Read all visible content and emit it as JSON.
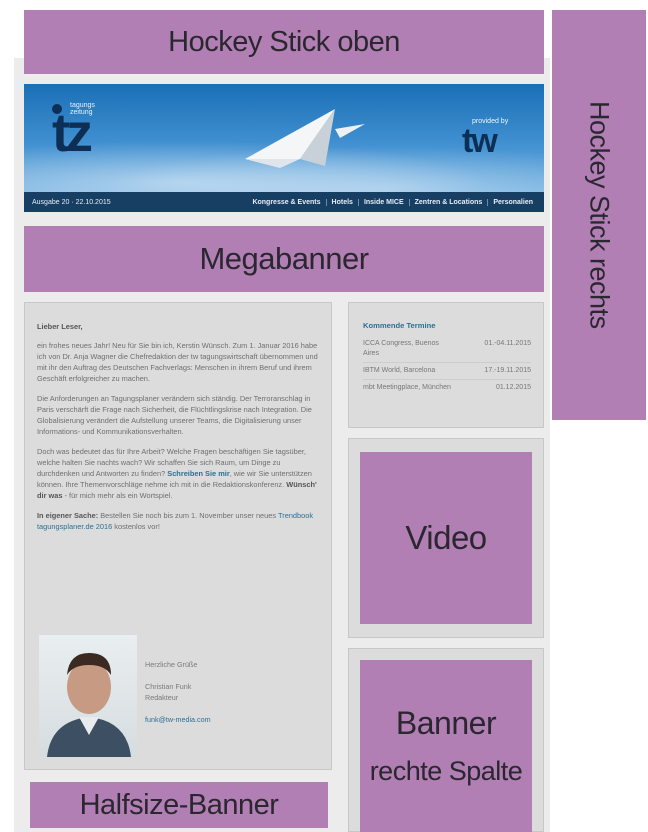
{
  "labels": {
    "hockey_top": "Hockey Stick oben",
    "hockey_right": "Hockey Stick rechts",
    "megabanner": "Megabanner",
    "video": "Video",
    "banner_right_line1": "Banner",
    "banner_right_line2": "rechte Spalte",
    "halfsize": "Halfsize-Banner"
  },
  "header": {
    "logo_text": "tz",
    "logo_sub": "tagungs zeitung",
    "provided_by": "provided by",
    "provider_logo": "tw",
    "issue": "Ausgabe 20 · 22.10.2015",
    "nav": [
      "Kongresse & Events",
      "Hotels",
      "Inside MICE",
      "Zentren & Locations",
      "Personalien"
    ]
  },
  "letter": {
    "greeting": "Lieber Leser,",
    "p1": "ein frohes neues Jahr! Neu für Sie bin ich, Kerstin Wünsch. Zum 1. Januar 2016 habe ich von Dr. Anja Wagner die Chefredaktion der tw tagungswirtschaft übernommen und mit ihr den Auftrag des Deutschen Fachverlags: Menschen in ihrem Beruf und ihrem Geschäft erfolgreicher zu machen.",
    "p2": "Die Anforderungen an Tagungsplaner verändern sich ständig. Der Terroranschlag in Paris verschärft die Frage nach Sicherheit, die Flüchtlingskrise nach Integration. Die Globalisierung verändert die Aufstellung unserer Teams, die Digitalisierung unser Informations- und Kommunikationsverhalten.",
    "p3_a": "Doch was bedeutet das für Ihre Arbeit? Welche Fragen beschäftigen Sie tagsüber, welche halten Sie nachts wach? Wir schaffen Sie sich Raum, um Dinge zu durchdenken und Antworten zu finden?",
    "p3_link": "Schreiben Sie mir",
    "p3_b": ", wie wir Sie unterstützen können. Ihre Themenvorschläge nehme ich mit in die Redaktionskonferenz.",
    "p3_bold": "Wünsch' dir was",
    "p3_c": " - für mich mehr als ein Wortspiel.",
    "p4_bold": "In eigener Sache:",
    "p4_a": " Bestellen Sie noch bis zum 1. November unser neues ",
    "p4_link": "Trendbook tagungsplaner.de 2016",
    "p4_b": " kostenlos vor!"
  },
  "signature": {
    "closing": "Herzliche Grüße",
    "name": "Christian Funk",
    "role": "Redakteur",
    "email": "funk@tw-media.com"
  },
  "events": {
    "title": "Kommende Termine",
    "items": [
      {
        "name": "ICCA Congress, Buenos Aires",
        "date": "01.-04.11.2015"
      },
      {
        "name": "IBTM World, Barcelona",
        "date": "17.-19.11.2015"
      },
      {
        "name": "mbt Meetingplace, München",
        "date": "01.12.2015"
      }
    ]
  },
  "colors": {
    "ad_placeholder": "#b17fb3",
    "nav_bar": "#173f63",
    "link": "#2c6f94"
  }
}
